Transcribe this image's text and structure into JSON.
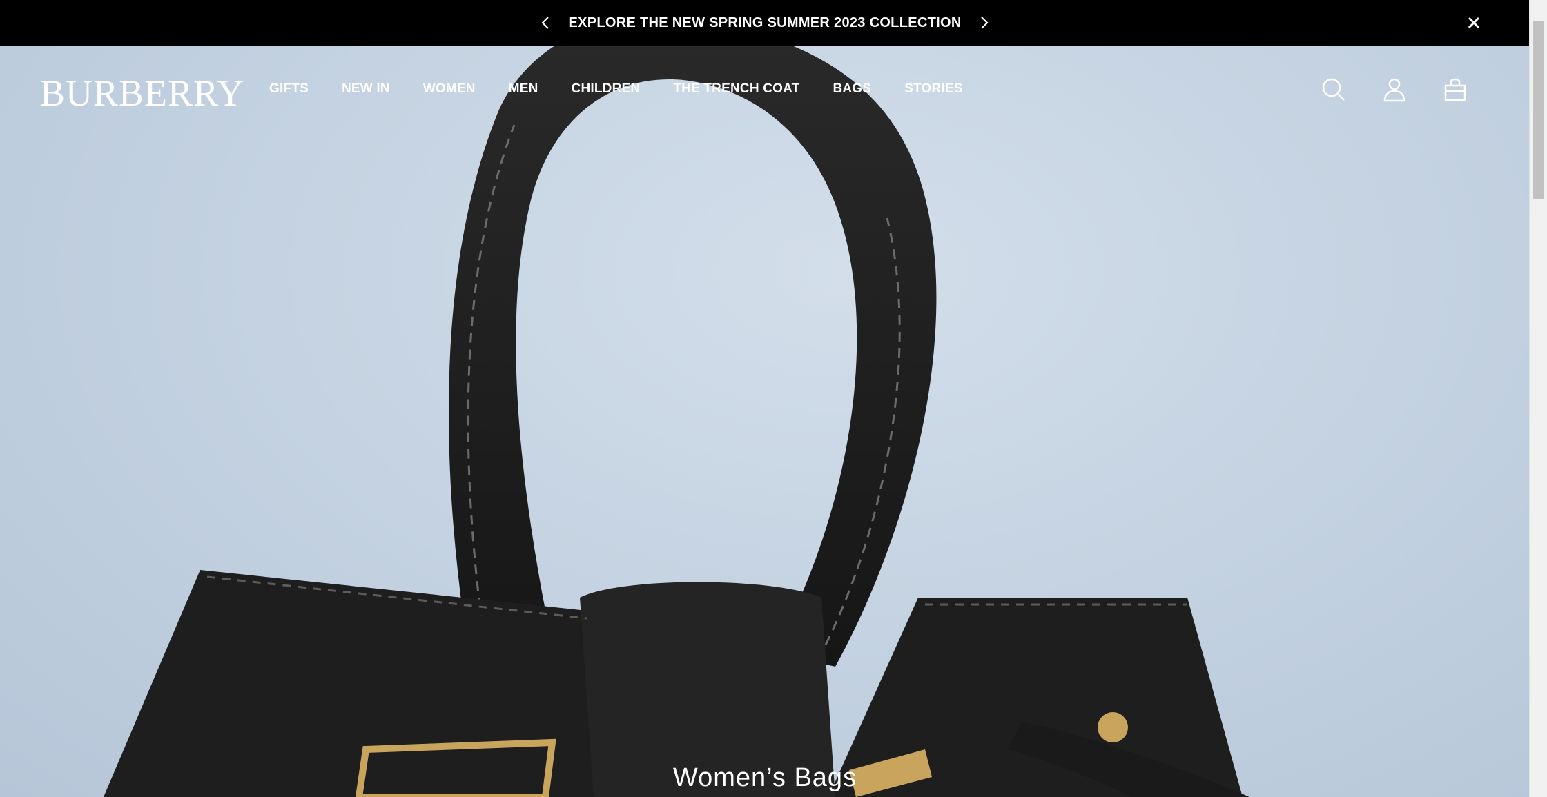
{
  "promo": {
    "text": "EXPLORE THE NEW SPRING SUMMER 2023 COLLECTION",
    "prev_icon": "chevron-left-icon",
    "next_icon": "chevron-right-icon",
    "close_icon": "close-icon"
  },
  "header": {
    "logo": "BURBERRY",
    "nav": [
      {
        "label": "GIFTS"
      },
      {
        "label": "NEW IN"
      },
      {
        "label": "WOMEN"
      },
      {
        "label": "MEN"
      },
      {
        "label": "CHILDREN"
      },
      {
        "label": "THE TRENCH COAT"
      },
      {
        "label": "BAGS"
      },
      {
        "label": "STORIES"
      }
    ],
    "icons": [
      "search-icon",
      "account-icon",
      "bag-icon"
    ]
  },
  "hero": {
    "caption": "Women’s Bags"
  },
  "colors": {
    "promo_bg": "#000000",
    "hero_bg": "#c9d6e3",
    "leather": "#1c1c1c",
    "hardware": "#c9a45c"
  }
}
